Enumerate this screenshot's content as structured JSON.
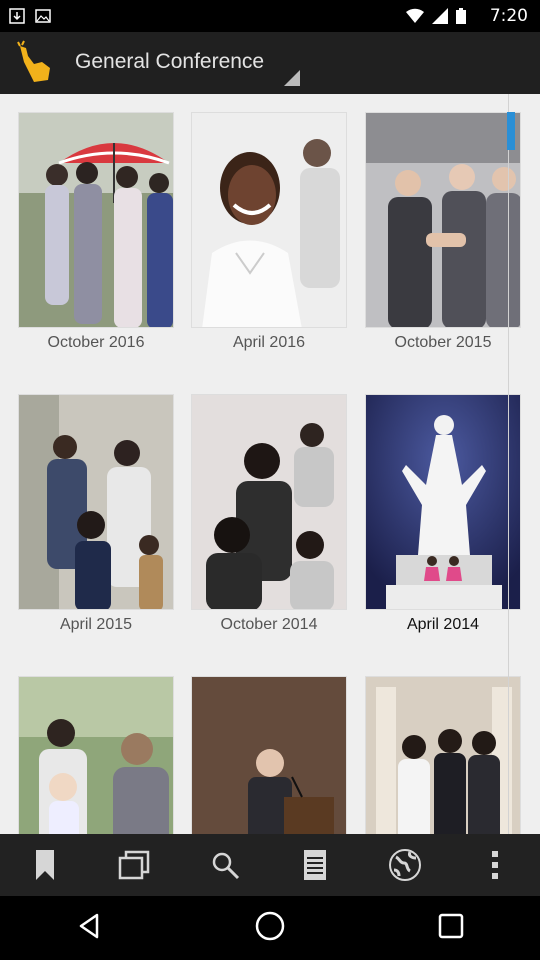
{
  "status_bar": {
    "time": "7:20"
  },
  "app_bar": {
    "title": "General Conference"
  },
  "conferences": [
    {
      "label": "October 2016",
      "selected": false
    },
    {
      "label": "April 2016",
      "selected": false
    },
    {
      "label": "October 2015",
      "selected": false
    },
    {
      "label": "April 2015",
      "selected": false
    },
    {
      "label": "October 2014",
      "selected": false
    },
    {
      "label": "April 2014",
      "selected": true
    },
    {
      "label": "",
      "selected": false
    },
    {
      "label": "",
      "selected": false
    },
    {
      "label": "",
      "selected": false
    }
  ],
  "bottom_tabs": [
    {
      "icon": "bookmark-icon"
    },
    {
      "icon": "windows-icon"
    },
    {
      "icon": "search-icon"
    },
    {
      "icon": "notes-icon"
    },
    {
      "icon": "globe-icon"
    },
    {
      "icon": "more-icon"
    }
  ],
  "nav_bar": [
    "back-icon",
    "home-icon",
    "recents-icon"
  ],
  "colors": {
    "app_bar": "#202020",
    "accent": "#2a8fd6",
    "content_bg": "#efefef"
  }
}
